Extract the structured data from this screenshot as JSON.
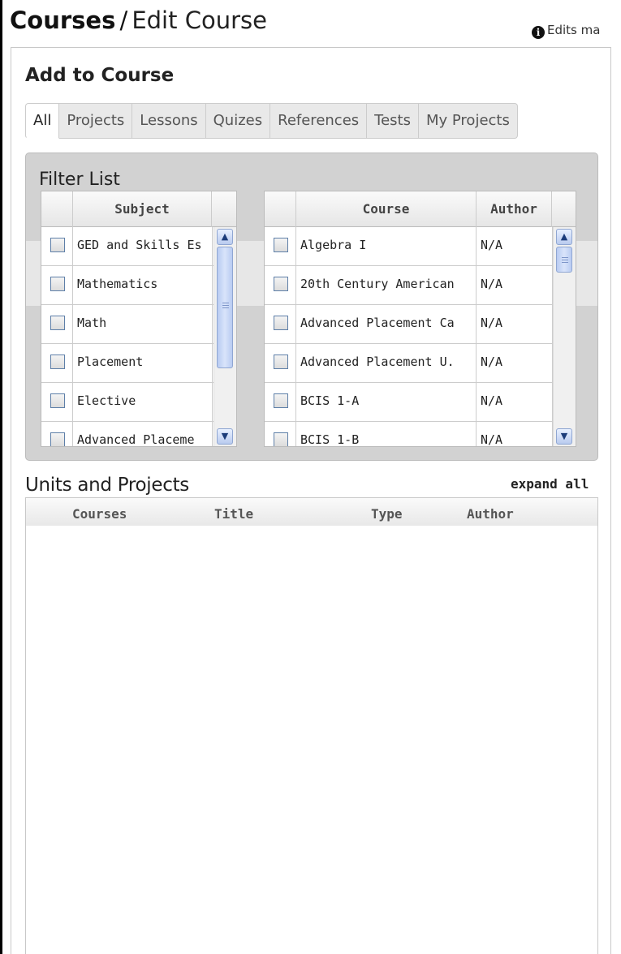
{
  "header": {
    "title_primary": "Courses",
    "title_separator": "/",
    "title_secondary": "Edit Course",
    "notice_text": "Edits ma"
  },
  "add_to_course": {
    "title": "Add to Course",
    "tabs": [
      {
        "label": "All",
        "active": true
      },
      {
        "label": "Projects",
        "active": false
      },
      {
        "label": "Lessons",
        "active": false
      },
      {
        "label": "Quizes",
        "active": false
      },
      {
        "label": "References",
        "active": false
      },
      {
        "label": "Tests",
        "active": false
      },
      {
        "label": "My Projects",
        "active": false
      }
    ]
  },
  "filter": {
    "title": "Filter List",
    "subject_grid": {
      "header": "Subject",
      "rows": [
        "GED and  Skills Es",
        "Mathematics",
        "Math",
        "Placement",
        "Elective",
        "Advanced Placeme"
      ]
    },
    "course_grid": {
      "headers": {
        "course": "Course",
        "author": "Author"
      },
      "rows": [
        {
          "course": "Algebra I",
          "author": "N/A"
        },
        {
          "course": "20th Century American",
          "author": "N/A"
        },
        {
          "course": "Advanced Placement Ca",
          "author": "N/A"
        },
        {
          "course": "Advanced Placement U.",
          "author": "N/A"
        },
        {
          "course": "BCIS 1-A",
          "author": "N/A"
        },
        {
          "course": "BCIS 1-B",
          "author": "N/A"
        }
      ]
    }
  },
  "units": {
    "title": "Units and Projects",
    "expand_label": "expand all",
    "columns": [
      "Courses",
      "Title",
      "Type",
      "Author"
    ]
  },
  "colors": {
    "filter_background": "#d2d2d2",
    "checkbox_border": "#5e7fa8",
    "scrollbar_accent": "#8fa6d2"
  }
}
